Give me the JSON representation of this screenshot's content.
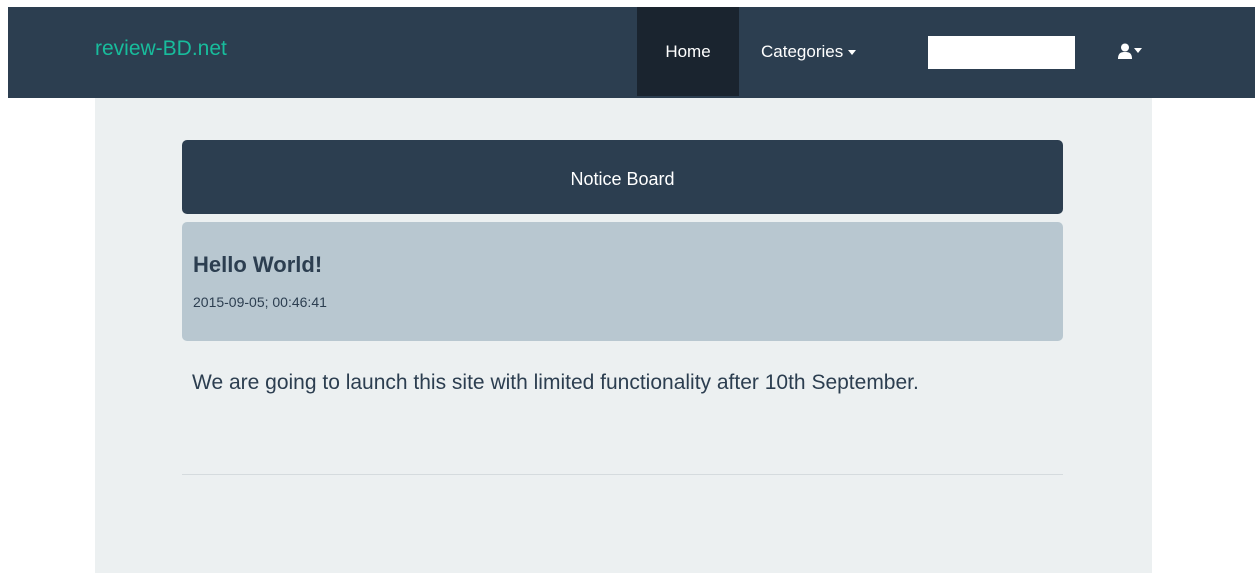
{
  "navbar": {
    "brand": "review-BD.net",
    "home_label": "Home",
    "categories_label": "Categories",
    "search_value": "",
    "user_icon": "user-icon"
  },
  "notice_board": {
    "header": "Notice Board",
    "title": "Hello World!",
    "date": "2015-09-05; 00:46:41",
    "body": "We are going to launch this site with limited functionality after 10th September."
  },
  "colors": {
    "navbar_bg": "#2c3e50",
    "brand": "#18bc9c",
    "active_nav": "#1a242f",
    "page_bg": "#ecf0f1",
    "card_bg": "#b8c7d0"
  }
}
